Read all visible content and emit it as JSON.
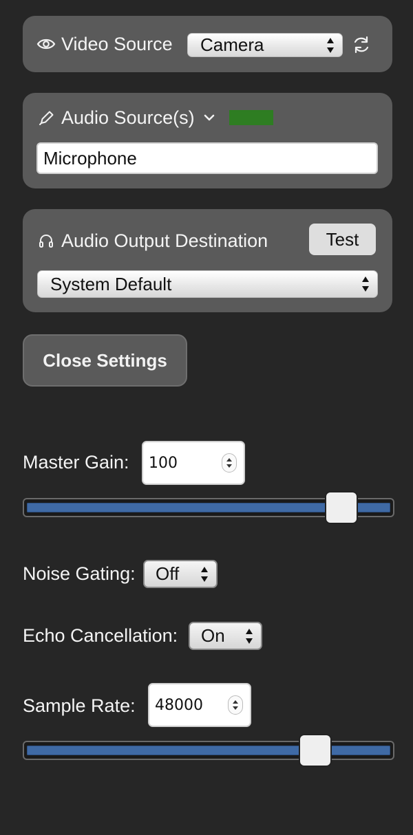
{
  "video": {
    "label": "Video Source",
    "selected": "Camera",
    "icons": {
      "label_icon": "eye-icon",
      "action_icon": "refresh-icon"
    }
  },
  "audio_source": {
    "label": "Audio Source(s)",
    "value": "Microphone",
    "meter_color": "#2e7d22",
    "icons": {
      "label_icon": "pen-icon",
      "toggle_icon": "chevron-down-icon"
    }
  },
  "audio_output": {
    "label": "Audio Output Destination",
    "test_label": "Test",
    "selected": "System Default",
    "icons": {
      "label_icon": "headphones-icon"
    }
  },
  "close_settings_label": "Close Settings",
  "master_gain": {
    "label": "Master Gain:",
    "value": "100",
    "slider_fraction": 0.86
  },
  "noise_gating": {
    "label": "Noise Gating:",
    "selected": "Off"
  },
  "echo_cancellation": {
    "label": "Echo Cancellation:",
    "selected": "On"
  },
  "sample_rate": {
    "label": "Sample Rate:",
    "value": "48000",
    "slider_fraction": 0.79
  },
  "colors": {
    "background": "#262626",
    "panel": "#5a5a5a",
    "slider_fill": "#3f6aa5"
  }
}
